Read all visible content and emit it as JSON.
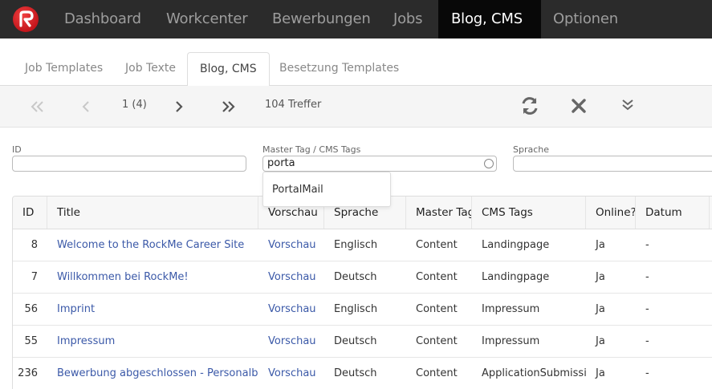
{
  "navbar": {
    "items": [
      {
        "label": "Dashboard"
      },
      {
        "label": "Workcenter"
      },
      {
        "label": "Bewerbungen"
      },
      {
        "label": "Jobs"
      },
      {
        "label": "Blog, CMS"
      },
      {
        "label": "Optionen"
      }
    ],
    "active": "Blog, CMS"
  },
  "subtabs": {
    "items": [
      {
        "label": "Job Templates"
      },
      {
        "label": "Job Texte"
      },
      {
        "label": "Blog, CMS"
      },
      {
        "label": "Besetzung Templates"
      }
    ],
    "active": "Blog, CMS"
  },
  "pager": {
    "page_info": "1 (4)",
    "hits": "104 Treffer"
  },
  "filters": {
    "id_label": "ID",
    "id_value": "",
    "tag_label": "Master Tag / CMS Tags",
    "tag_value": "porta",
    "language_label": "Sprache",
    "language_value": "",
    "suggestion": "PortalMail"
  },
  "table": {
    "headers": [
      "ID",
      "Title",
      "Vorschau",
      "Sprache",
      "Master Tag",
      "CMS Tags",
      "Online?",
      "Datum"
    ],
    "rows": [
      {
        "id": "8",
        "title": "Welcome to the RockMe Career Site",
        "preview": "Vorschau",
        "language": "Englisch",
        "master_tag": "Content",
        "cms_tags": "Landingpage",
        "online": "Ja",
        "date": "-"
      },
      {
        "id": "7",
        "title": "Willkommen bei RockMe!",
        "preview": "Vorschau",
        "language": "Deutsch",
        "master_tag": "Content",
        "cms_tags": "Landingpage",
        "online": "Ja",
        "date": "-"
      },
      {
        "id": "56",
        "title": "Imprint",
        "preview": "Vorschau",
        "language": "Englisch",
        "master_tag": "Content",
        "cms_tags": "Impressum",
        "online": "Ja",
        "date": "-"
      },
      {
        "id": "55",
        "title": "Impressum",
        "preview": "Vorschau",
        "language": "Deutsch",
        "master_tag": "Content",
        "cms_tags": "Impressum",
        "online": "Ja",
        "date": "-"
      },
      {
        "id": "236",
        "title": "Bewerbung abgeschlossen - Personalberater",
        "preview": "Vorschau",
        "language": "Deutsch",
        "master_tag": "Content",
        "cms_tags": "ApplicationSubmission",
        "online": "Ja",
        "date": "-"
      }
    ]
  },
  "icons": {
    "first": "double-chevron-left-icon",
    "prev": "chevron-left-icon",
    "next": "chevron-right-icon",
    "last": "double-chevron-right-icon",
    "refresh": "refresh-icon",
    "reset": "close-icon",
    "expand": "double-chevron-down-icon"
  },
  "colors": {
    "navbar_bg": "#2b2b2b",
    "navbar_active_bg": "#080808",
    "link": "#3b59a8",
    "brand_red": "#c4161c"
  }
}
